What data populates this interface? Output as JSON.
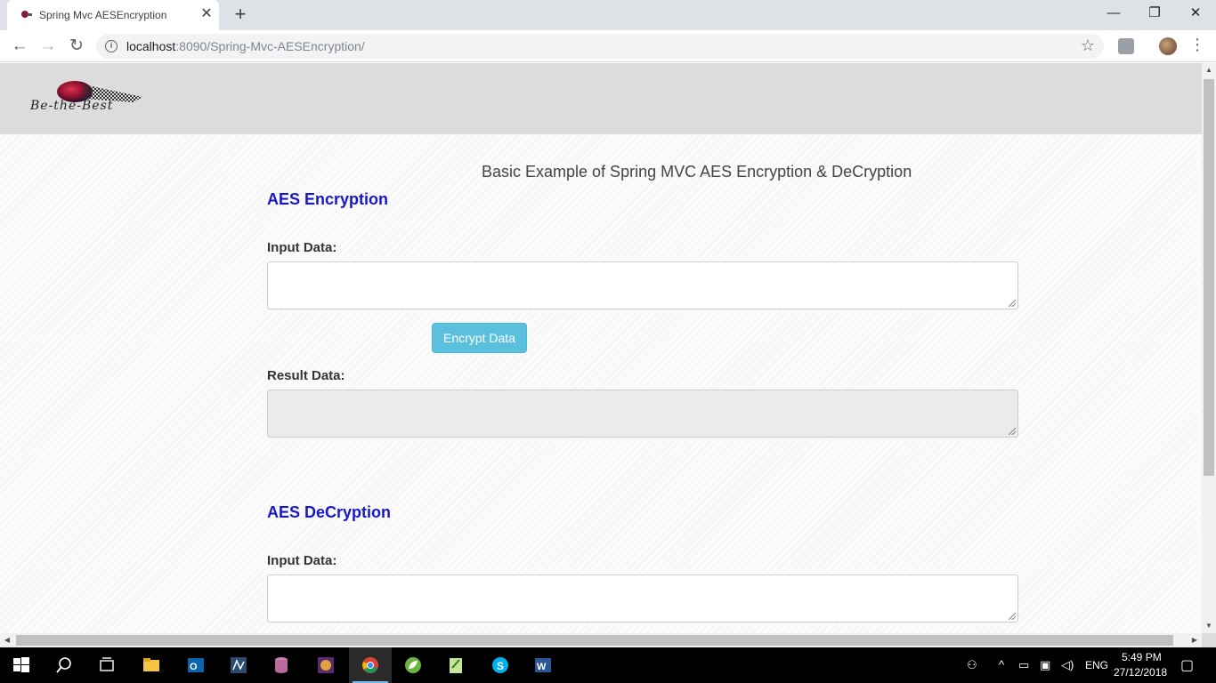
{
  "browser": {
    "tab_title": "Spring Mvc AESEncryption",
    "url_host": "localhost",
    "url_rest": ":8090/Spring-Mvc-AESEncryption/"
  },
  "page": {
    "logo_text": "Be-the-Best",
    "heading": "Basic Example of Spring MVC AES Encryption & DeCryption",
    "encryption": {
      "title": "AES Encryption",
      "input_label": "Input Data:",
      "input_value": "",
      "button_label": "Encrypt Data",
      "result_label": "Result Data:",
      "result_value": ""
    },
    "decryption": {
      "title": "AES DeCryption",
      "input_label": "Input Data:",
      "input_value": ""
    }
  },
  "taskbar": {
    "apps": [
      "windows-start",
      "search",
      "task-view",
      "file-explorer",
      "outlook",
      "mysql-workbench",
      "database-tool",
      "game-app",
      "chrome",
      "spring-tool-suite",
      "notepad-plus-plus",
      "skype",
      "word"
    ],
    "language": "ENG",
    "time": "5:49 PM",
    "date": "27/12/2018"
  },
  "colors": {
    "section_title": "#1717c9",
    "button": "#5bc0de",
    "header_band": "#dcdcdc"
  }
}
